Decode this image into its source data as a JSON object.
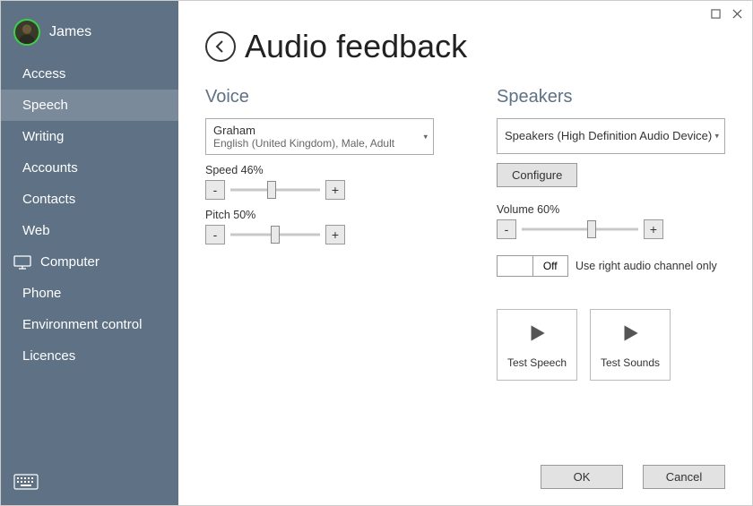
{
  "window": {
    "maximize_tooltip": "Maximize",
    "close_tooltip": "Close"
  },
  "sidebar": {
    "profile_name": "James",
    "items": [
      {
        "label": "Access",
        "active": false
      },
      {
        "label": "Speech",
        "active": true
      },
      {
        "label": "Writing",
        "active": false
      },
      {
        "label": "Accounts",
        "active": false
      },
      {
        "label": "Contacts",
        "active": false
      },
      {
        "label": "Web",
        "active": false
      },
      {
        "label": "Computer",
        "active": false,
        "has_icon": true
      },
      {
        "label": "Phone",
        "active": false
      },
      {
        "label": "Environment control",
        "active": false
      },
      {
        "label": "Licences",
        "active": false
      }
    ]
  },
  "page": {
    "title": "Audio feedback"
  },
  "voice": {
    "section_title": "Voice",
    "selected_name": "Graham",
    "selected_detail": "English (United Kingdom), Male, Adult",
    "speed": {
      "label": "Speed 46%",
      "value_pct": 46,
      "minus": "-",
      "plus": "+"
    },
    "pitch": {
      "label": "Pitch 50%",
      "value_pct": 50,
      "minus": "-",
      "plus": "+"
    }
  },
  "speakers": {
    "section_title": "Speakers",
    "selected": "Speakers (High Definition Audio Device)",
    "configure_label": "Configure",
    "volume": {
      "label": "Volume 60%",
      "value_pct": 60,
      "minus": "-",
      "plus": "+"
    },
    "right_channel": {
      "state": "Off",
      "label": "Use right audio channel only"
    },
    "test_speech_label": "Test Speech",
    "test_sounds_label": "Test Sounds"
  },
  "footer": {
    "ok": "OK",
    "cancel": "Cancel"
  }
}
